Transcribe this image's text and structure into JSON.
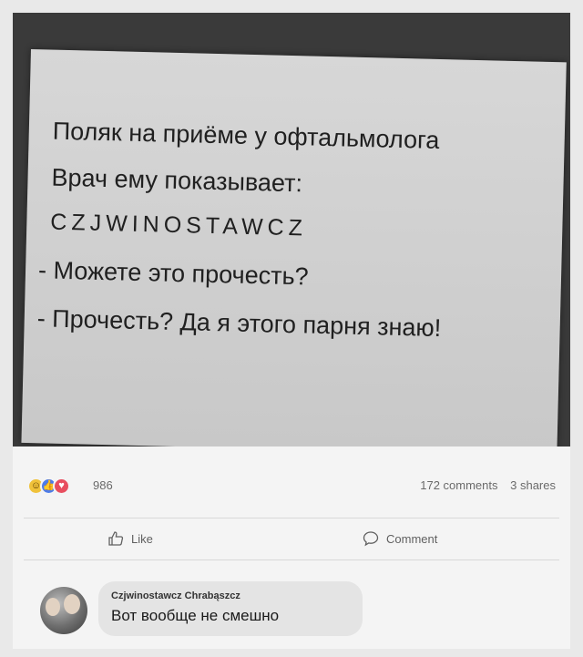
{
  "note": {
    "line1": "Поляк на приёме у офтальмолога",
    "line2": "Врач ему показывает:",
    "chart_letters": "CZJWINOSTAWCZ",
    "line4": "- Можете это прочесть?",
    "line5": "- Прочесть? Да я этого парня знаю!"
  },
  "reactions": {
    "icons": [
      "haha-icon",
      "like-icon",
      "love-icon"
    ],
    "count": "986"
  },
  "stats": {
    "comments": "172 comments",
    "shares": "3 shares"
  },
  "actions": {
    "like_label": "Like",
    "comment_label": "Comment"
  },
  "comment": {
    "author": "Czjwinostawcz Chrabąszcz",
    "text": "Вот вообще не смешно"
  }
}
